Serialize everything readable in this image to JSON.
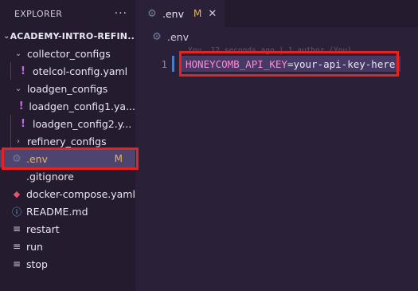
{
  "sidebar": {
    "title": "EXPLORER",
    "more": "···",
    "root": "ACADEMY-INTRO-REFIN...",
    "items": [
      {
        "label": "collector_configs",
        "type": "folder"
      },
      {
        "label": "otelcol-config.yaml",
        "type": "yaml"
      },
      {
        "label": "loadgen_configs",
        "type": "folder"
      },
      {
        "label": "loadgen_config1.ya...",
        "type": "yaml"
      },
      {
        "label": "loadgen_config2.y...",
        "type": "yaml"
      },
      {
        "label": "refinery_configs",
        "type": "folder"
      },
      {
        "label": ".env",
        "type": "env",
        "badge": "M"
      },
      {
        "label": ".gitignore",
        "type": "plain"
      },
      {
        "label": "docker-compose.yaml",
        "type": "docker"
      },
      {
        "label": "README.md",
        "type": "info"
      },
      {
        "label": "restart",
        "type": "lines"
      },
      {
        "label": "run",
        "type": "lines"
      },
      {
        "label": "stop",
        "type": "lines"
      }
    ]
  },
  "tab": {
    "label": ".env",
    "modified": "M",
    "close": "✕"
  },
  "breadcrumb": ".env",
  "blame": "You, 12 seconds ago | 1 author (You)",
  "code": {
    "line_number": "1",
    "key": "HONEYCOMB_API_KEY",
    "eq": "=",
    "value": "your-api-key-here"
  },
  "colors": {
    "highlight": "#e8231f",
    "accent_modified": "#e8b35a"
  }
}
